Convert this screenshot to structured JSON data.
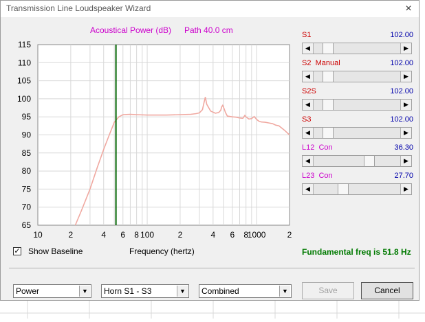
{
  "window": {
    "title": "Transmission Line Loudspeaker Wizard",
    "close_glyph": "×"
  },
  "chart_data": {
    "type": "line",
    "title": "Acoustical Power (dB)",
    "subtitle": "Path 40.0 cm",
    "xlabel": "Frequency (hertz)",
    "xscale": "log",
    "xlim": [
      10,
      2000
    ],
    "ylim": [
      65,
      115
    ],
    "ytick_labels": [
      "115",
      "110",
      "105",
      "100",
      "95",
      "90",
      "85",
      "80",
      "75",
      "70",
      "65"
    ],
    "xtick_labels": [
      {
        "f": 10,
        "label": "10"
      },
      {
        "f": 20,
        "label": "2"
      },
      {
        "f": 40,
        "label": "4"
      },
      {
        "f": 60,
        "label": "6"
      },
      {
        "f": 80,
        "label": "8"
      },
      {
        "f": 100,
        "label": "100"
      },
      {
        "f": 200,
        "label": "2"
      },
      {
        "f": 400,
        "label": "4"
      },
      {
        "f": 600,
        "label": "6"
      },
      {
        "f": 800,
        "label": "8"
      },
      {
        "f": 1000,
        "label": "1000"
      },
      {
        "f": 2000,
        "label": "2"
      }
    ],
    "grid": true,
    "marker_freq": 51.8,
    "series": [
      {
        "color": "#f0a8a0",
        "x": [
          22,
          25,
          30,
          35,
          40,
          45,
          50,
          55,
          60,
          70,
          80,
          100,
          150,
          200,
          250,
          280,
          300,
          320,
          330,
          340,
          350,
          380,
          420,
          450,
          470,
          480,
          490,
          500,
          520,
          540,
          600,
          650,
          700,
          750,
          780,
          800,
          850,
          900,
          950,
          1000,
          1050,
          1100,
          1200,
          1300,
          1400,
          1500,
          1600,
          1800,
          2000
        ],
        "y": [
          65,
          69,
          75,
          81,
          86,
          90,
          93.5,
          95,
          95.6,
          95.7,
          95.6,
          95.5,
          95.5,
          95.6,
          95.7,
          95.9,
          96.1,
          97.0,
          98.8,
          100.5,
          98.5,
          96.6,
          96.0,
          96.2,
          96.8,
          97.8,
          98.2,
          97.6,
          96.2,
          95.2,
          95.0,
          94.9,
          94.7,
          94.6,
          95.4,
          95.0,
          94.4,
          94.5,
          95.1,
          94.3,
          93.8,
          93.6,
          93.5,
          93.3,
          93.1,
          92.7,
          92.5,
          91.3,
          90.0
        ]
      }
    ]
  },
  "sliders": [
    {
      "label": "S1",
      "value": "102.00",
      "color": "#cc0000",
      "thumb": 0.12
    },
    {
      "label": "S2  Manual",
      "value": "102.00",
      "color": "#cc0000",
      "thumb": 0.12
    },
    {
      "label": "S2S",
      "value": "102.00",
      "color": "#cc0000",
      "thumb": 0.12
    },
    {
      "label": "S3",
      "value": "102.00",
      "color": "#cc0000",
      "thumb": 0.12
    },
    {
      "label": "L12  Con",
      "value": "36.30",
      "color": "#cc00cc",
      "thumb": 0.66
    },
    {
      "label": "L23  Con",
      "value": "27.70",
      "color": "#cc00cc",
      "thumb": 0.32
    }
  ],
  "baseline": {
    "checked_glyph": "✓",
    "label": "Show Baseline"
  },
  "fundamental": "Fundamental freq is 51.8 Hz",
  "combos": [
    {
      "value": "Power"
    },
    {
      "value": "Horn S1 - S3"
    },
    {
      "value": "Combined"
    }
  ],
  "buttons": {
    "save": "Save",
    "cancel": "Cancel"
  },
  "colors": {
    "plot_bg": "#ffffff",
    "grid": "#d8d8d8",
    "marker": "#006400",
    "title_color": "#cc00cc"
  }
}
